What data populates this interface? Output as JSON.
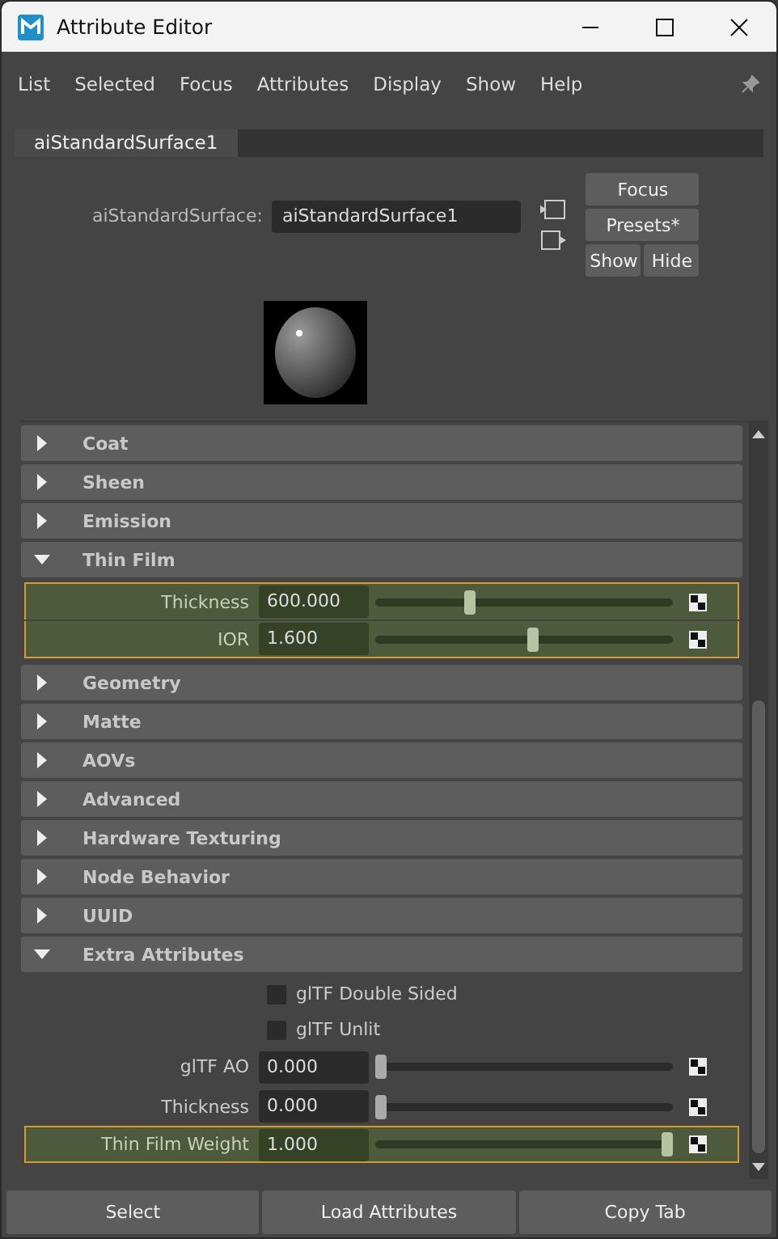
{
  "window": {
    "title": "Attribute Editor"
  },
  "menu": [
    "List",
    "Selected",
    "Focus",
    "Attributes",
    "Display",
    "Show",
    "Help"
  ],
  "tabs": [
    {
      "label": "aiStandardSurface1",
      "selected": true
    }
  ],
  "node": {
    "label": "aiStandardSurface:",
    "value": "aiStandardSurface1"
  },
  "node_buttons": [
    "Focus",
    "Presets*",
    "Show",
    "Hide"
  ],
  "sections": [
    {
      "title": "Coat",
      "expanded": false
    },
    {
      "title": "Sheen",
      "expanded": false
    },
    {
      "title": "Emission",
      "expanded": false
    },
    {
      "title": "Thin Film",
      "expanded": true,
      "attributes": [
        {
          "kind": "slider",
          "label": "Thickness",
          "value": "600.000",
          "level": 0.31,
          "highlighted": true
        },
        {
          "kind": "slider",
          "label": "IOR",
          "value": "1.600",
          "level": 0.53,
          "highlighted": true
        }
      ]
    },
    {
      "title": "Geometry",
      "expanded": false
    },
    {
      "title": "Matte",
      "expanded": false
    },
    {
      "title": "AOVs",
      "expanded": false
    },
    {
      "title": "Advanced",
      "expanded": false
    },
    {
      "title": "Hardware Texturing",
      "expanded": false
    },
    {
      "title": "Node Behavior",
      "expanded": false
    },
    {
      "title": "UUID",
      "expanded": false
    },
    {
      "title": "Extra Attributes",
      "expanded": true,
      "attributes": [
        {
          "kind": "checkbox",
          "label": "glTF Double Sided",
          "checked": false
        },
        {
          "kind": "checkbox",
          "label": "glTF Unlit",
          "checked": false
        },
        {
          "kind": "slider",
          "label": "glTF AO",
          "value": "0.000",
          "level": 0,
          "highlighted": false
        },
        {
          "kind": "slider",
          "label": "Thickness",
          "value": "0.000",
          "level": 0,
          "highlighted": false
        },
        {
          "kind": "slider",
          "label": "Thin Film Weight",
          "value": "1.000",
          "level": 1,
          "highlighted": true
        }
      ]
    }
  ],
  "bottom_buttons": [
    "Select",
    "Load Attributes",
    "Copy Tab"
  ]
}
